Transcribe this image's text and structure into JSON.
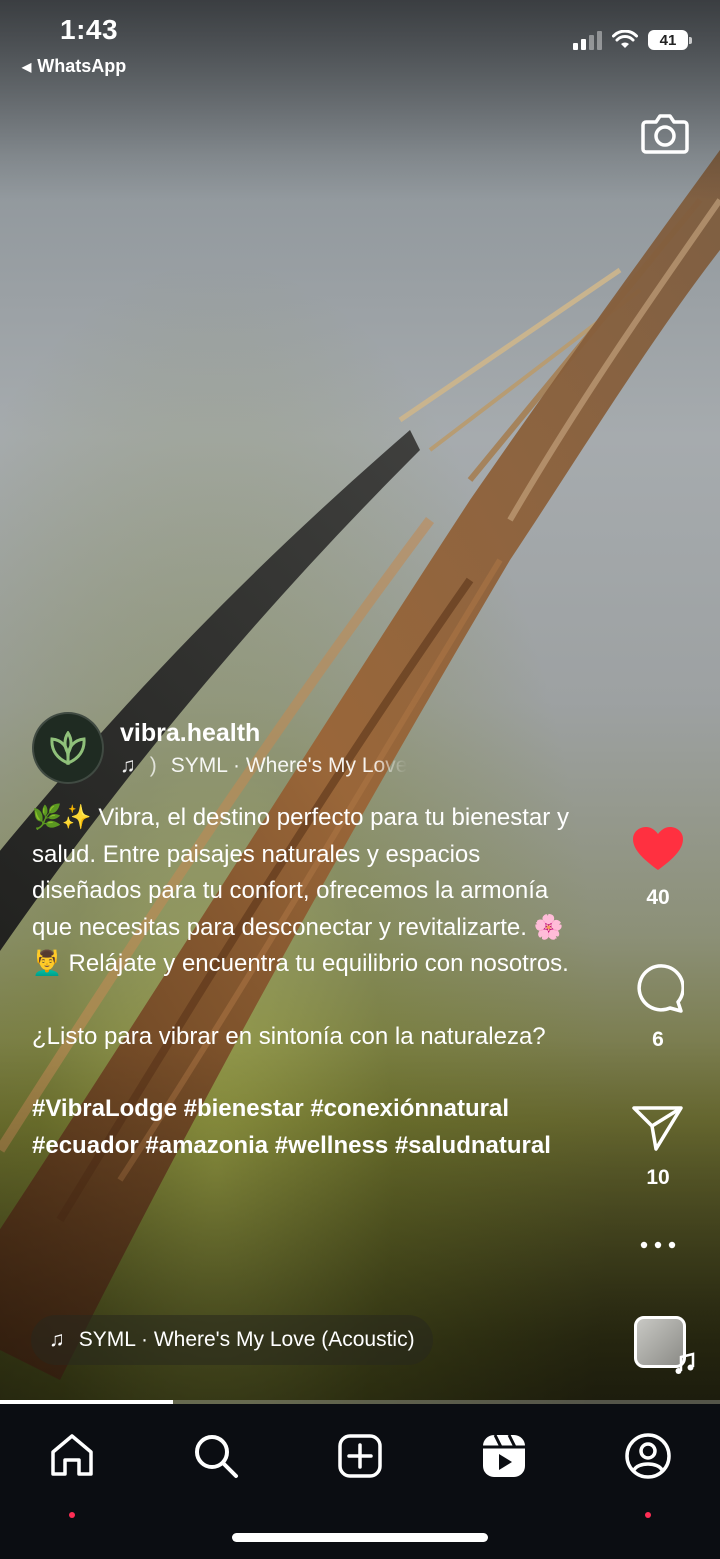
{
  "status_bar": {
    "time": "1:43",
    "back_app": "WhatsApp",
    "battery": "41"
  },
  "post": {
    "author": "vibra.health",
    "author_music_track": "SYML · Where's My Love (Acoustic)",
    "caption": {
      "paragraph_1": "🌿✨ Vibra, el destino perfecto para tu bienestar y salud. Entre paisajes naturales y espacios diseñados para tu confort, ofrecemos la armonía que necesitas para desconectar y revitalizarte. 🌸💆‍♂️ Relájate y encuentra tu equilibrio con nosotros.",
      "paragraph_2": "¿Listo para vibrar en sintonía con la naturaleza?",
      "hashtags": "#VibraLodge #bienestar #conexiónnatural #ecuador #amazonia #wellness #saludnatural"
    },
    "music_pill": "SYML · Where's My Love (Acoustic)",
    "likes": "40",
    "comments": "6",
    "shares": "10",
    "progress": 0.24
  },
  "colors": {
    "like": "#ff3040",
    "nav_dot": "#ff2d55",
    "avatar_leaf": "#8fc07a"
  },
  "nav": {
    "items": [
      "home-icon",
      "search-icon",
      "create-icon",
      "reels-icon",
      "profile-icon"
    ]
  }
}
